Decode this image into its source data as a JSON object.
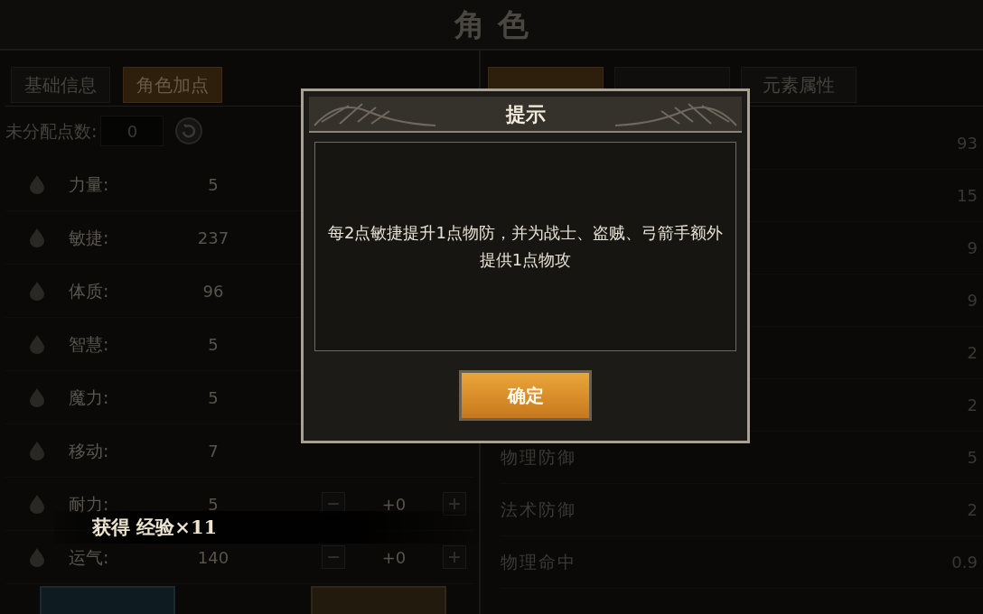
{
  "title": "角色",
  "left_tabs": [
    {
      "label": "基础信息",
      "selected": false
    },
    {
      "label": "角色加点",
      "selected": true
    }
  ],
  "unassigned": {
    "label": "未分配点数:",
    "value": "0"
  },
  "stats": [
    {
      "label": "力量:",
      "value": "5"
    },
    {
      "label": "敏捷:",
      "value": "237"
    },
    {
      "label": "体质:",
      "value": "96"
    },
    {
      "label": "智慧:",
      "value": "5"
    },
    {
      "label": "魔力:",
      "value": "5"
    },
    {
      "label": "移动:",
      "value": "7"
    },
    {
      "label": "耐力:",
      "value": "5",
      "bonus": "+0"
    },
    {
      "label": "运气:",
      "value": "140",
      "bonus": "+0"
    }
  ],
  "right_tabs": [
    {
      "selected": true
    },
    {
      "selected": false
    },
    {
      "label": "元素属性",
      "selected": false
    }
  ],
  "attributes": [
    {
      "value": "93"
    },
    {
      "value": "15"
    },
    {
      "value": "9"
    },
    {
      "value": "9"
    },
    {
      "value": "2"
    },
    {
      "value": "2"
    },
    {
      "label": "物理防御",
      "value": "5"
    },
    {
      "label": "法术防御",
      "value": "2"
    },
    {
      "label": "物理命中",
      "value": "0.9"
    }
  ],
  "dialog": {
    "title": "提示",
    "message": "每2点敏捷提升1点物防，并为战士、盗贼、弓箭手额外提供1点物攻",
    "confirm": "确定"
  },
  "toast": "获得 经验×11"
}
